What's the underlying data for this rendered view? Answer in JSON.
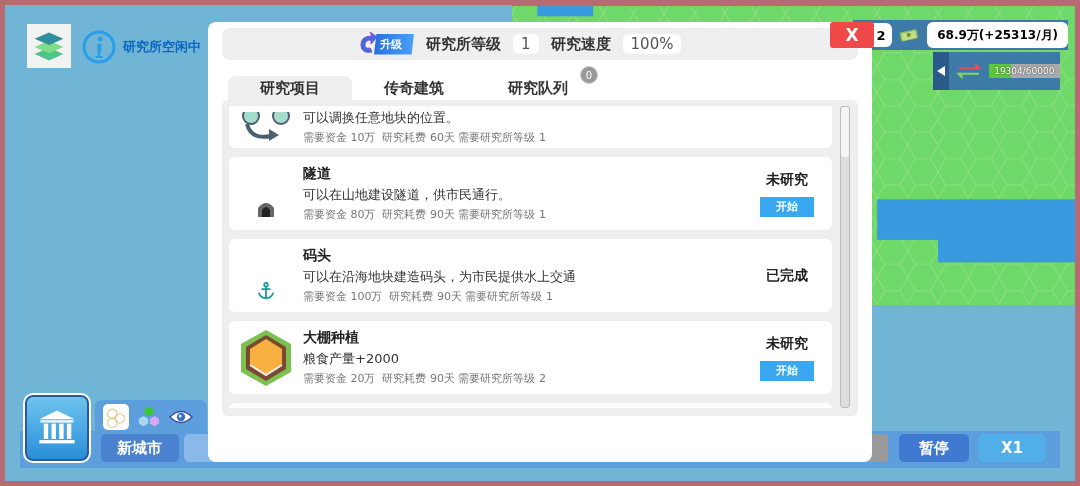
{
  "hud": {
    "status_text": "研究所空闲中",
    "count_text": "2",
    "money_text": "68.9万(+25313/月)",
    "progress": {
      "text": "19304/60000",
      "level": 0.32
    }
  },
  "bottom_bar": {
    "city_tabs": [
      {
        "label": "新城市",
        "selected": true
      },
      {
        "selected": false
      }
    ],
    "pause_button": "暂停",
    "speed_button": "X1"
  },
  "dialog": {
    "upgrade_label": "升级",
    "level_label": "研究所等级",
    "level_value": "1",
    "speed_label": "研究速度",
    "speed_value": "100%",
    "close_label": "X",
    "tabs": [
      {
        "label": "研究项目",
        "selected": true
      },
      {
        "label": "传奇建筑",
        "selected": false
      },
      {
        "label": "研究队列",
        "selected": false,
        "badge": "0"
      }
    ],
    "items": [
      {
        "kind": "swap",
        "description": "可以调换任意地块的位置。",
        "requirements": "需要资金 10万  研究耗费 60天 需要研究所等级 1"
      },
      {
        "kind": "tunnel",
        "title": "隧道",
        "description": "可以在山地建设隧道，供市民通行。",
        "requirements": "需要资金 80万  研究耗费 90天 需要研究所等级 1",
        "status": "未研究",
        "action": "开始"
      },
      {
        "kind": "anchor",
        "title": "码头",
        "description": "可以在沿海地块建造码头，为市民提供水上交通",
        "requirements": "需要资金 100万  研究耗费 90天 需要研究所等级 1",
        "status": "已完成"
      },
      {
        "kind": "greenhouse",
        "title": "大棚种植",
        "description": "粮食产量+2000",
        "requirements": "需要资金 20万  研究耗费 90天 需要研究所等级 2",
        "status": "未研究",
        "action": "开始"
      },
      {
        "kind": "empty"
      }
    ]
  }
}
